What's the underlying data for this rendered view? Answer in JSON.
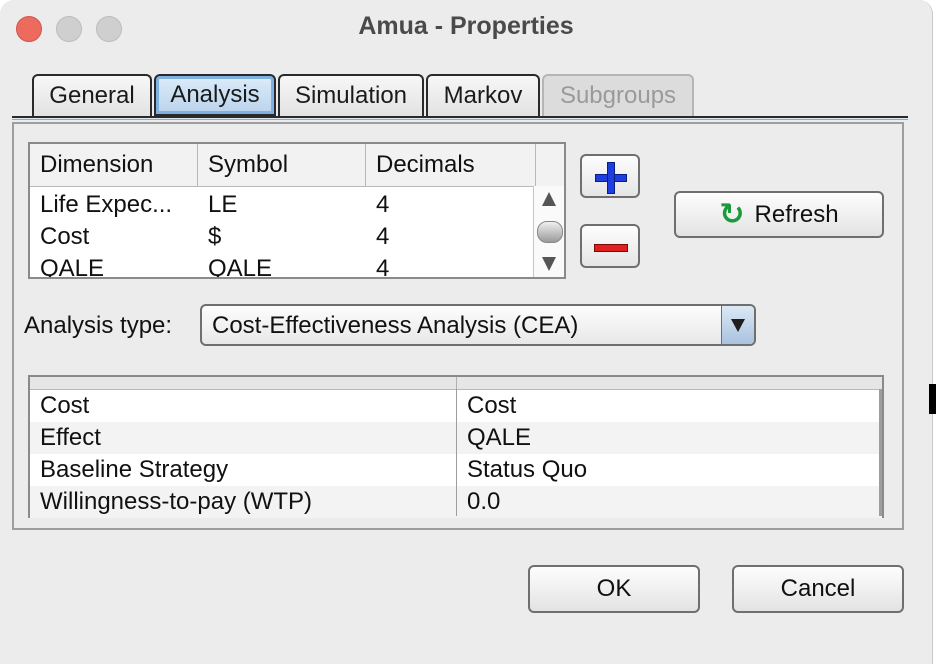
{
  "window": {
    "title": "Amua - Properties"
  },
  "tabs": [
    {
      "label": "General",
      "state": "normal"
    },
    {
      "label": "Analysis",
      "state": "selected"
    },
    {
      "label": "Simulation",
      "state": "normal"
    },
    {
      "label": "Markov",
      "state": "normal"
    },
    {
      "label": "Subgroups",
      "state": "disabled"
    }
  ],
  "dimensions": {
    "headers": [
      "Dimension",
      "Symbol",
      "Decimals"
    ],
    "rows": [
      {
        "dimension": "Life Expec...",
        "symbol": "LE",
        "decimals": "4"
      },
      {
        "dimension": "Cost",
        "symbol": "$",
        "decimals": "4"
      },
      {
        "dimension": "QALE",
        "symbol": "QALE",
        "decimals": "4"
      }
    ]
  },
  "buttons": {
    "add_icon": "plus-icon",
    "remove_icon": "minus-icon",
    "refresh_label": "Refresh",
    "refresh_icon": "refresh-icon",
    "ok_label": "OK",
    "cancel_label": "Cancel"
  },
  "analysis_type": {
    "label": "Analysis type:",
    "selected": "Cost-Effectiveness Analysis (CEA)"
  },
  "params": [
    {
      "name": "Cost",
      "value": "Cost"
    },
    {
      "name": "Effect",
      "value": "QALE"
    },
    {
      "name": "Baseline Strategy",
      "value": "Status Quo"
    },
    {
      "name": "Willingness-to-pay (WTP)",
      "value": "0.0"
    }
  ],
  "colors": {
    "close": "#ed6a5e",
    "selected_tab": "#b9d3ec",
    "plus": "#1f3ee0",
    "minus": "#e0201f",
    "refresh": "#1b9a3a"
  }
}
